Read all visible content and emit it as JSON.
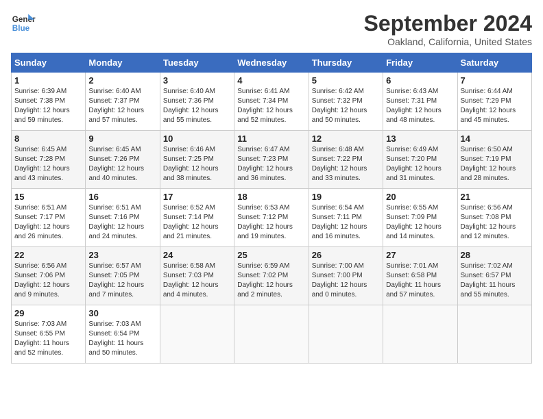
{
  "header": {
    "logo_line1": "General",
    "logo_line2": "Blue",
    "month_title": "September 2024",
    "location": "Oakland, California, United States"
  },
  "calendar": {
    "weekdays": [
      "Sunday",
      "Monday",
      "Tuesday",
      "Wednesday",
      "Thursday",
      "Friday",
      "Saturday"
    ],
    "weeks": [
      [
        {
          "day": "1",
          "info": "Sunrise: 6:39 AM\nSunset: 7:38 PM\nDaylight: 12 hours\nand 59 minutes."
        },
        {
          "day": "2",
          "info": "Sunrise: 6:40 AM\nSunset: 7:37 PM\nDaylight: 12 hours\nand 57 minutes."
        },
        {
          "day": "3",
          "info": "Sunrise: 6:40 AM\nSunset: 7:36 PM\nDaylight: 12 hours\nand 55 minutes."
        },
        {
          "day": "4",
          "info": "Sunrise: 6:41 AM\nSunset: 7:34 PM\nDaylight: 12 hours\nand 52 minutes."
        },
        {
          "day": "5",
          "info": "Sunrise: 6:42 AM\nSunset: 7:32 PM\nDaylight: 12 hours\nand 50 minutes."
        },
        {
          "day": "6",
          "info": "Sunrise: 6:43 AM\nSunset: 7:31 PM\nDaylight: 12 hours\nand 48 minutes."
        },
        {
          "day": "7",
          "info": "Sunrise: 6:44 AM\nSunset: 7:29 PM\nDaylight: 12 hours\nand 45 minutes."
        }
      ],
      [
        {
          "day": "8",
          "info": "Sunrise: 6:45 AM\nSunset: 7:28 PM\nDaylight: 12 hours\nand 43 minutes."
        },
        {
          "day": "9",
          "info": "Sunrise: 6:45 AM\nSunset: 7:26 PM\nDaylight: 12 hours\nand 40 minutes."
        },
        {
          "day": "10",
          "info": "Sunrise: 6:46 AM\nSunset: 7:25 PM\nDaylight: 12 hours\nand 38 minutes."
        },
        {
          "day": "11",
          "info": "Sunrise: 6:47 AM\nSunset: 7:23 PM\nDaylight: 12 hours\nand 36 minutes."
        },
        {
          "day": "12",
          "info": "Sunrise: 6:48 AM\nSunset: 7:22 PM\nDaylight: 12 hours\nand 33 minutes."
        },
        {
          "day": "13",
          "info": "Sunrise: 6:49 AM\nSunset: 7:20 PM\nDaylight: 12 hours\nand 31 minutes."
        },
        {
          "day": "14",
          "info": "Sunrise: 6:50 AM\nSunset: 7:19 PM\nDaylight: 12 hours\nand 28 minutes."
        }
      ],
      [
        {
          "day": "15",
          "info": "Sunrise: 6:51 AM\nSunset: 7:17 PM\nDaylight: 12 hours\nand 26 minutes."
        },
        {
          "day": "16",
          "info": "Sunrise: 6:51 AM\nSunset: 7:16 PM\nDaylight: 12 hours\nand 24 minutes."
        },
        {
          "day": "17",
          "info": "Sunrise: 6:52 AM\nSunset: 7:14 PM\nDaylight: 12 hours\nand 21 minutes."
        },
        {
          "day": "18",
          "info": "Sunrise: 6:53 AM\nSunset: 7:12 PM\nDaylight: 12 hours\nand 19 minutes."
        },
        {
          "day": "19",
          "info": "Sunrise: 6:54 AM\nSunset: 7:11 PM\nDaylight: 12 hours\nand 16 minutes."
        },
        {
          "day": "20",
          "info": "Sunrise: 6:55 AM\nSunset: 7:09 PM\nDaylight: 12 hours\nand 14 minutes."
        },
        {
          "day": "21",
          "info": "Sunrise: 6:56 AM\nSunset: 7:08 PM\nDaylight: 12 hours\nand 12 minutes."
        }
      ],
      [
        {
          "day": "22",
          "info": "Sunrise: 6:56 AM\nSunset: 7:06 PM\nDaylight: 12 hours\nand 9 minutes."
        },
        {
          "day": "23",
          "info": "Sunrise: 6:57 AM\nSunset: 7:05 PM\nDaylight: 12 hours\nand 7 minutes."
        },
        {
          "day": "24",
          "info": "Sunrise: 6:58 AM\nSunset: 7:03 PM\nDaylight: 12 hours\nand 4 minutes."
        },
        {
          "day": "25",
          "info": "Sunrise: 6:59 AM\nSunset: 7:02 PM\nDaylight: 12 hours\nand 2 minutes."
        },
        {
          "day": "26",
          "info": "Sunrise: 7:00 AM\nSunset: 7:00 PM\nDaylight: 12 hours\nand 0 minutes."
        },
        {
          "day": "27",
          "info": "Sunrise: 7:01 AM\nSunset: 6:58 PM\nDaylight: 11 hours\nand 57 minutes."
        },
        {
          "day": "28",
          "info": "Sunrise: 7:02 AM\nSunset: 6:57 PM\nDaylight: 11 hours\nand 55 minutes."
        }
      ],
      [
        {
          "day": "29",
          "info": "Sunrise: 7:03 AM\nSunset: 6:55 PM\nDaylight: 11 hours\nand 52 minutes."
        },
        {
          "day": "30",
          "info": "Sunrise: 7:03 AM\nSunset: 6:54 PM\nDaylight: 11 hours\nand 50 minutes."
        },
        {
          "day": "",
          "info": ""
        },
        {
          "day": "",
          "info": ""
        },
        {
          "day": "",
          "info": ""
        },
        {
          "day": "",
          "info": ""
        },
        {
          "day": "",
          "info": ""
        }
      ]
    ]
  }
}
